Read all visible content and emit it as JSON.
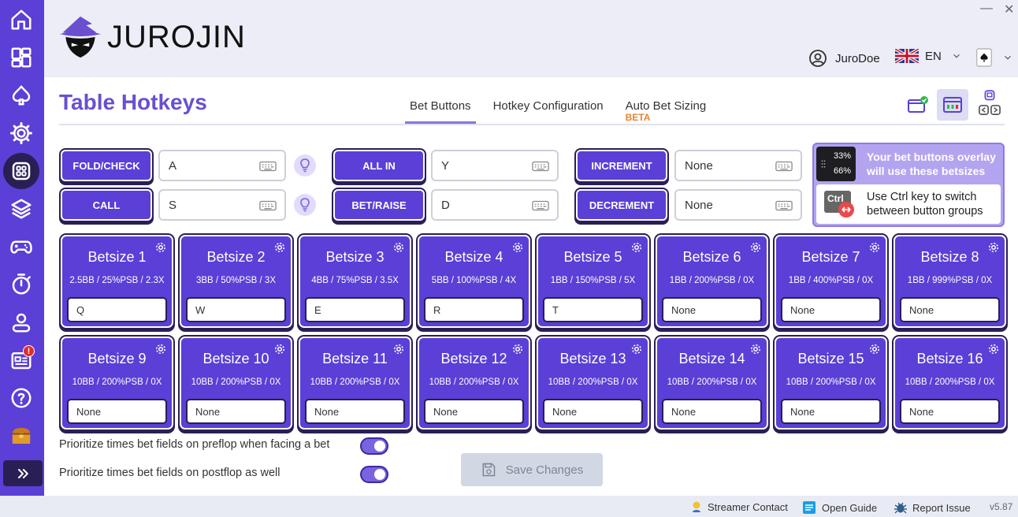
{
  "app": {
    "brand": "JUROJIN",
    "minimize": "—",
    "close": "✕"
  },
  "user": {
    "name": "JuroDoe"
  },
  "language": {
    "code": "EN"
  },
  "page": {
    "title": "Table Hotkeys"
  },
  "tabs": [
    {
      "label": "Bet Buttons",
      "active": true
    },
    {
      "label": "Hotkey Configuration"
    },
    {
      "label": "Auto Bet Sizing",
      "badge": "BETA"
    }
  ],
  "hotkeys": {
    "fold_check": {
      "label": "FOLD/CHECK",
      "value": "A"
    },
    "call": {
      "label": "CALL",
      "value": "S"
    },
    "all_in": {
      "label": "ALL IN",
      "value": "Y"
    },
    "bet_raise": {
      "label": "BET/RAISE",
      "value": "D"
    },
    "increment": {
      "label": "INCREMENT",
      "value": "None"
    },
    "decrement": {
      "label": "DECREMENT",
      "value": "None"
    }
  },
  "info": {
    "pct_top": "33%",
    "pct_bottom": "66%",
    "overlay_text_1": "Your bet buttons overlay",
    "overlay_text_2": "will use these betsizes",
    "ctrl_label": "Ctrl",
    "ctrl_text_1": "Use Ctrl key to switch",
    "ctrl_text_2": "between button groups"
  },
  "betsizes": [
    {
      "name": "Betsize 1",
      "desc": "2.5BB / 25%PSB / 2.3X",
      "key": "Q"
    },
    {
      "name": "Betsize 2",
      "desc": "3BB / 50%PSB / 3X",
      "key": "W"
    },
    {
      "name": "Betsize 3",
      "desc": "4BB / 75%PSB / 3.5X",
      "key": "E"
    },
    {
      "name": "Betsize 4",
      "desc": "5BB / 100%PSB / 4X",
      "key": "R"
    },
    {
      "name": "Betsize 5",
      "desc": "1BB / 150%PSB / 5X",
      "key": "T"
    },
    {
      "name": "Betsize 6",
      "desc": "1BB / 200%PSB / 0X",
      "key": "None"
    },
    {
      "name": "Betsize 7",
      "desc": "1BB / 400%PSB / 0X",
      "key": "None"
    },
    {
      "name": "Betsize 8",
      "desc": "1BB / 999%PSB / 0X",
      "key": "None"
    },
    {
      "name": "Betsize 9",
      "desc": "10BB / 200%PSB / 0X",
      "key": "None"
    },
    {
      "name": "Betsize 10",
      "desc": "10BB / 200%PSB / 0X",
      "key": "None"
    },
    {
      "name": "Betsize 11",
      "desc": "10BB / 200%PSB / 0X",
      "key": "None"
    },
    {
      "name": "Betsize 12",
      "desc": "10BB / 200%PSB / 0X",
      "key": "None"
    },
    {
      "name": "Betsize 13",
      "desc": "10BB / 200%PSB / 0X",
      "key": "None"
    },
    {
      "name": "Betsize 14",
      "desc": "10BB / 200%PSB / 0X",
      "key": "None"
    },
    {
      "name": "Betsize 15",
      "desc": "10BB / 200%PSB / 0X",
      "key": "None"
    },
    {
      "name": "Betsize 16",
      "desc": "10BB / 200%PSB / 0X",
      "key": "None"
    }
  ],
  "toggles": [
    {
      "label": "Prioritize times bet fields on preflop when facing a bet",
      "on": true
    },
    {
      "label": "Prioritize times bet fields on postflop as well",
      "on": true
    }
  ],
  "save_button": {
    "label": "Save Changes"
  },
  "sidebar": {
    "notification_badge": "!"
  },
  "footer": {
    "streamer": "Streamer Contact",
    "guide": "Open Guide",
    "report": "Report Issue",
    "version": "v5.87"
  },
  "colors": {
    "primary": "#5b3fd6",
    "dark": "#2a1f55",
    "title": "#6a4fcf",
    "beta": "#e8832a"
  }
}
